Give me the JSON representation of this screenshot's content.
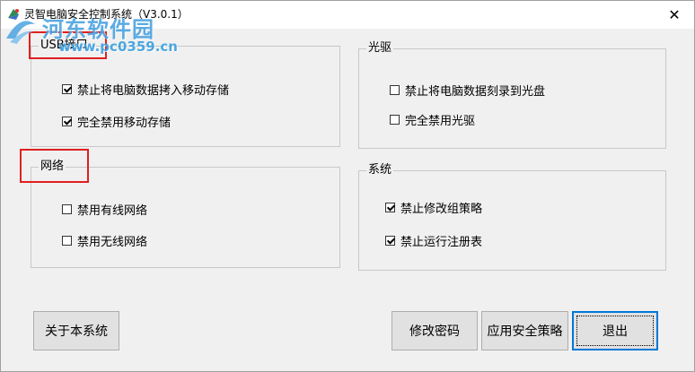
{
  "window": {
    "title": "灵智电脑安全控制系统（V3.0.1）",
    "close_symbol": "✕"
  },
  "watermark": {
    "name": "河东软件园",
    "url": "www.pc0359.cn"
  },
  "groups": {
    "usb": {
      "title": "USB接口",
      "items": [
        {
          "label": "禁止将电脑数据拷入移动存储",
          "checked": true
        },
        {
          "label": "完全禁用移动存储",
          "checked": true
        }
      ]
    },
    "optical": {
      "title": "光驱",
      "items": [
        {
          "label": "禁止将电脑数据刻录到光盘",
          "checked": false
        },
        {
          "label": "完全禁用光驱",
          "checked": false
        }
      ]
    },
    "network": {
      "title": "网络",
      "items": [
        {
          "label": "禁用有线网络",
          "checked": false
        },
        {
          "label": "禁用无线网络",
          "checked": false
        }
      ]
    },
    "system": {
      "title": "系统",
      "items": [
        {
          "label": "禁止修改组策略",
          "checked": true
        },
        {
          "label": "禁止运行注册表",
          "checked": true
        }
      ]
    }
  },
  "buttons": {
    "about": "关于本系统",
    "change_password": "修改密码",
    "apply_policy": "应用安全策略",
    "exit": "退出"
  },
  "colors": {
    "highlight": "#e02020",
    "default_button_border": "#0078d7",
    "watermark": "#4aa3e0"
  },
  "icons": {
    "app": "shield-app-icon",
    "close": "close-icon"
  }
}
